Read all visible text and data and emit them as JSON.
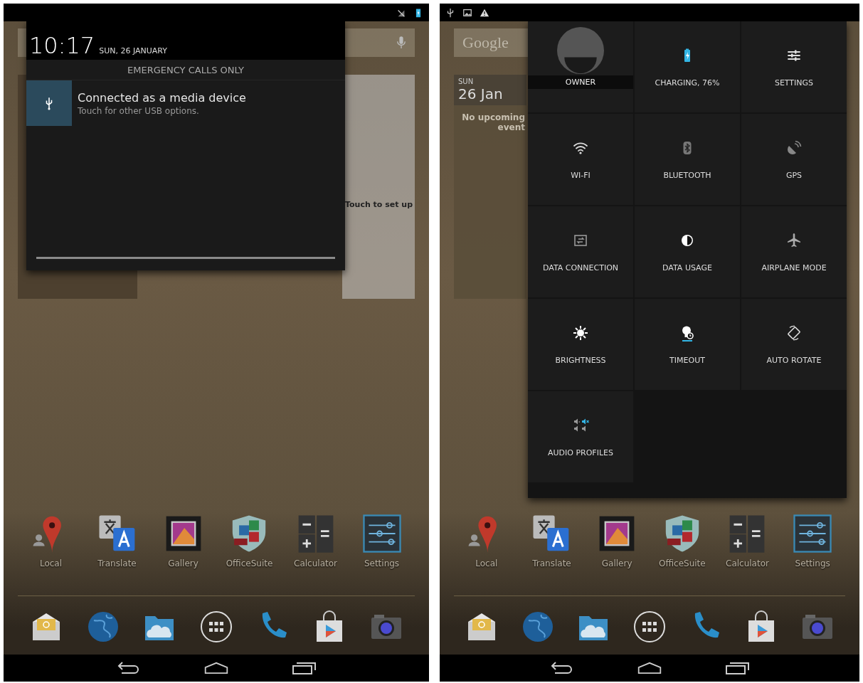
{
  "left_screen": {
    "notification_panel": {
      "time": "10:17",
      "date": "SUN, 26 JANUARY",
      "carrier": "EMERGENCY CALLS ONLY",
      "notifications": [
        {
          "title": "Connected as a media device",
          "text": "Touch for other USB options."
        }
      ]
    },
    "gmail_widget": {
      "text": "Touch to set up"
    },
    "apps": [
      {
        "label": "Local"
      },
      {
        "label": "Translate"
      },
      {
        "label": "Gallery"
      },
      {
        "label": "OfficeSuite"
      },
      {
        "label": "Calculator"
      },
      {
        "label": "Settings"
      }
    ]
  },
  "right_screen": {
    "search_logo": "Google",
    "calendar_widget": {
      "day": "SUN",
      "date": "26 Jan",
      "lines": [
        "No upcoming",
        "event"
      ]
    },
    "quick_settings": [
      {
        "label": "OWNER"
      },
      {
        "label": "CHARGING, 76%"
      },
      {
        "label": "SETTINGS"
      },
      {
        "label": "WI-FI"
      },
      {
        "label": "BLUETOOTH"
      },
      {
        "label": "GPS"
      },
      {
        "label": "DATA CONNECTION"
      },
      {
        "label": "DATA USAGE"
      },
      {
        "label": "AIRPLANE MODE"
      },
      {
        "label": "BRIGHTNESS"
      },
      {
        "label": "TIMEOUT"
      },
      {
        "label": "AUTO ROTATE"
      },
      {
        "label": "AUDIO PROFILES"
      }
    ],
    "apps": [
      {
        "label": "Local"
      },
      {
        "label": "Translate"
      },
      {
        "label": "Gallery"
      },
      {
        "label": "OfficeSuite"
      },
      {
        "label": "Calculator"
      },
      {
        "label": "Settings"
      }
    ]
  }
}
